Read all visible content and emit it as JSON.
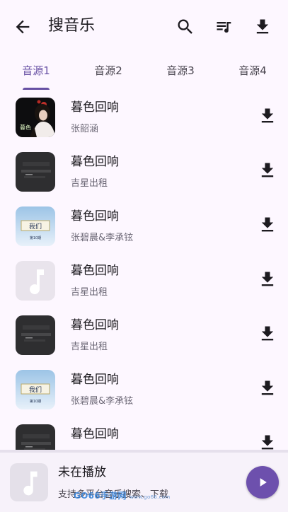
{
  "header": {
    "title": "搜音乐",
    "back_icon": "arrow-back-icon",
    "actions": [
      "search-icon",
      "playlist-icon",
      "download-icon"
    ]
  },
  "tabs": [
    {
      "label": "音源1",
      "active": true
    },
    {
      "label": "音源2",
      "active": false
    },
    {
      "label": "音源3",
      "active": false
    },
    {
      "label": "音源4",
      "active": false
    }
  ],
  "songs": [
    {
      "title": "暮色回响",
      "artist": "张韶涵",
      "cover": "portrait-cover"
    },
    {
      "title": "暮色回响",
      "artist": "吉星出租",
      "cover": "dark-cover"
    },
    {
      "title": "暮色回响",
      "artist": "张碧晨&李承铉",
      "cover": "show-cover"
    },
    {
      "title": "暮色回响",
      "artist": "吉星出租",
      "cover": "music-note-placeholder"
    },
    {
      "title": "暮色回响",
      "artist": "吉星出租",
      "cover": "dark-cover"
    },
    {
      "title": "暮色回响",
      "artist": "张碧晨&李承铉",
      "cover": "show-cover"
    },
    {
      "title": "暮色回响",
      "artist": "",
      "cover": "dark-cover"
    }
  ],
  "player": {
    "title": "未在播放",
    "subtitle": "支持多平台音乐搜索、下载"
  },
  "watermark": {
    "text": "GO66手游网",
    "url": "www.go66.com"
  },
  "colors": {
    "background": "#fdf7ff",
    "accent": "#6750a4",
    "play_button": "#6d50ad"
  }
}
